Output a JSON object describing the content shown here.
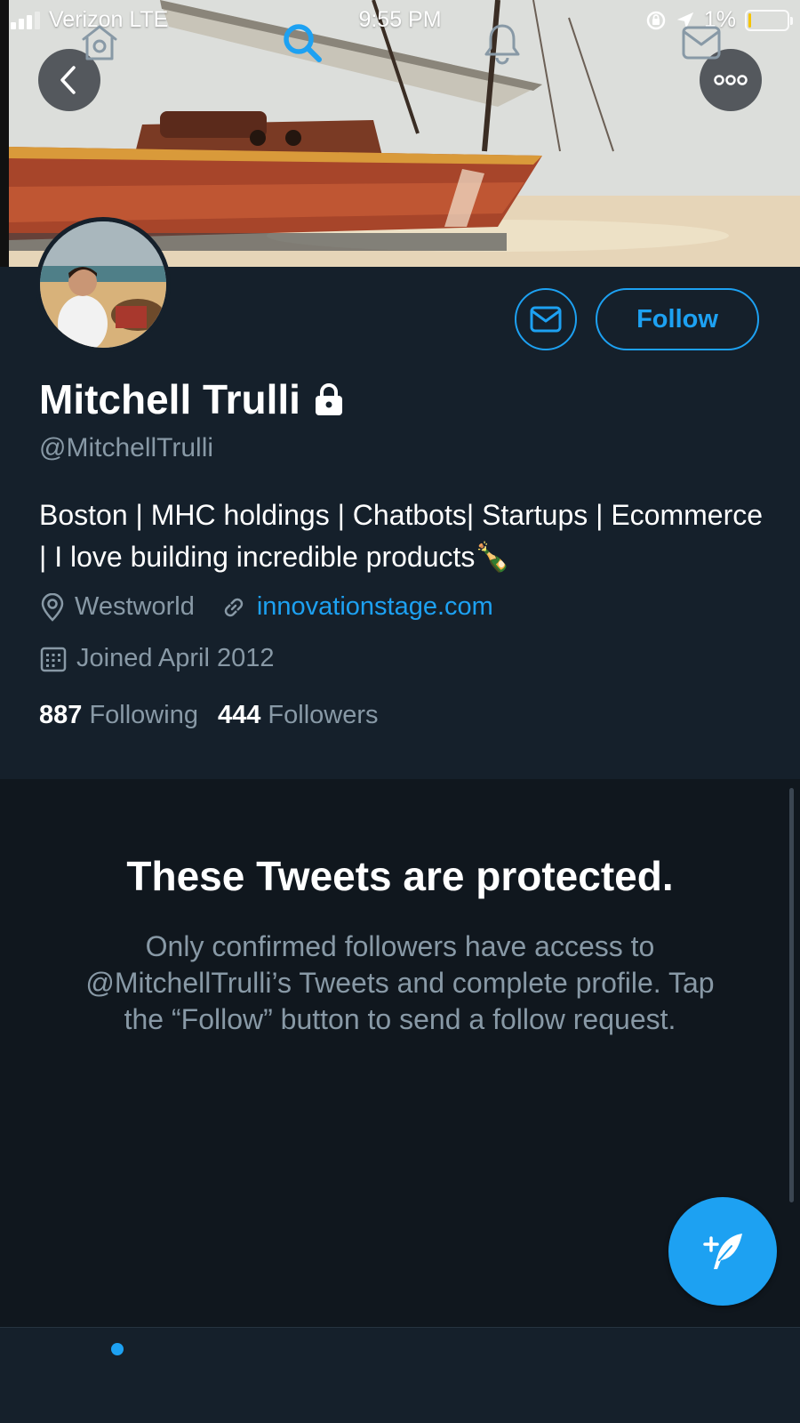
{
  "status_bar": {
    "carrier": "Verizon LTE",
    "time": "9:55 PM",
    "battery": "1%",
    "battery_level": 0.01
  },
  "header": {
    "back_icon": "chevron-left-icon",
    "more_icon": "more-icon"
  },
  "profile": {
    "name": "Mitchell Trulli",
    "handle": "@MitchellTrulli",
    "bio": "Boston | MHC holdings | Chatbots| Startups | Ecommerce | I love building incredible products🍾",
    "location": "Westworld",
    "website": "innovationstage.com",
    "joined": "Joined April 2012",
    "following_count": "887",
    "following_label": "Following",
    "followers_count": "444",
    "followers_label": "Followers",
    "follow_label": "Follow"
  },
  "protected": {
    "title": "These Tweets are protected.",
    "message": "Only confirmed followers have access to @MitchellTrulli’s Tweets and complete profile. Tap the “Follow” button to send a follow request."
  },
  "tabs": [
    {
      "name": "home",
      "icon": "home-icon",
      "has_badge": true
    },
    {
      "name": "search",
      "icon": "search-icon",
      "active": true
    },
    {
      "name": "notifications",
      "icon": "bell-icon"
    },
    {
      "name": "messages",
      "icon": "mail-icon"
    }
  ],
  "colors": {
    "accent": "#1da1f2",
    "background": "#15202b",
    "secondary_text": "#8899a6"
  }
}
